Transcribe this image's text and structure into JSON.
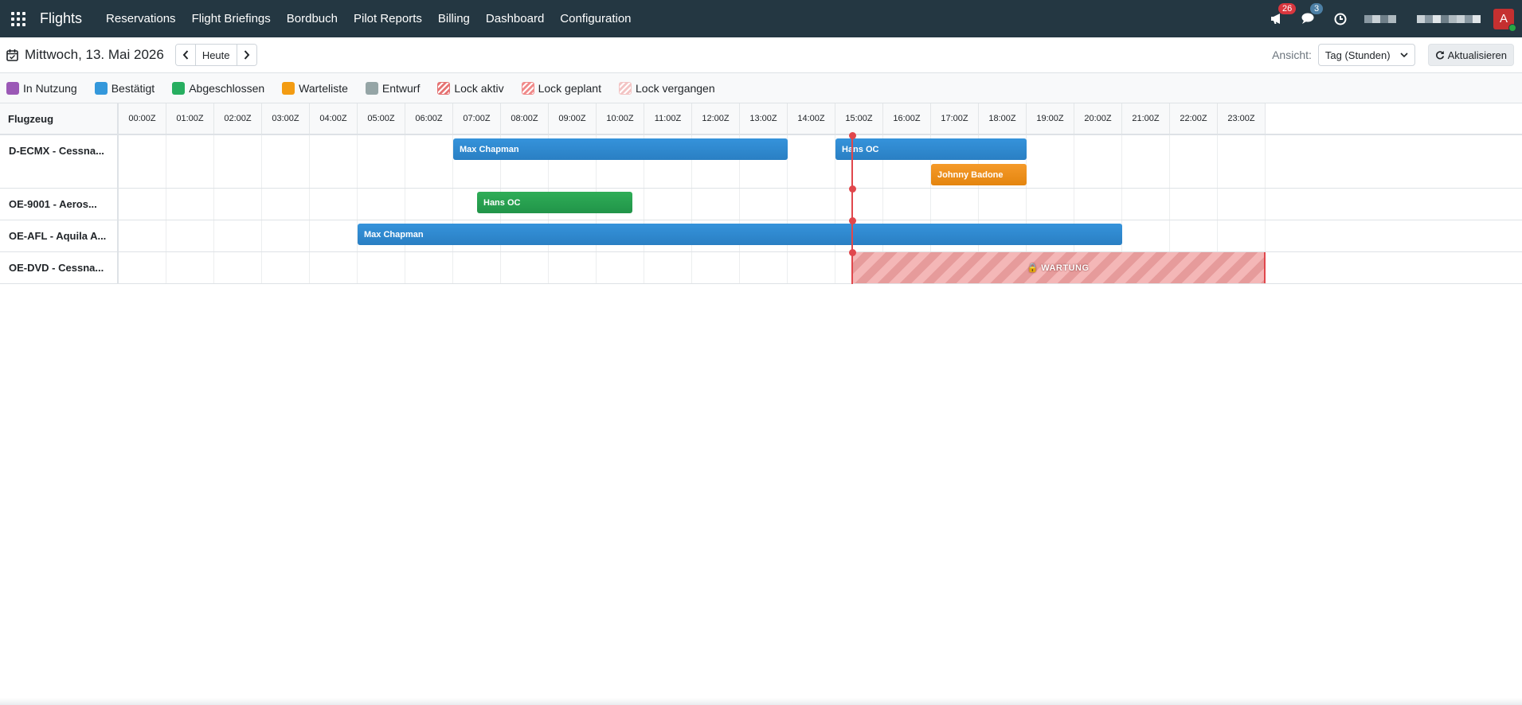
{
  "nav": {
    "brand": "Flights",
    "menu": [
      "Reservations",
      "Flight Briefings",
      "Bordbuch",
      "Pilot Reports",
      "Billing",
      "Dashboard",
      "Configuration"
    ],
    "notifications_count": "26",
    "messages_count": "3",
    "avatar_letter": "A"
  },
  "toolbar": {
    "date": "Mittwoch, 13. Mai 2026",
    "today_label": "Heute",
    "view_label": "Ansicht:",
    "view_value": "Tag (Stunden)",
    "refresh_label": "Aktualisieren"
  },
  "legend": [
    {
      "label": "In Nutzung",
      "color": "#9b59b6"
    },
    {
      "label": "Bestätigt",
      "color": "#3498db"
    },
    {
      "label": "Abgeschlossen",
      "color": "#27ae60"
    },
    {
      "label": "Warteliste",
      "color": "#f39c12"
    },
    {
      "label": "Entwurf",
      "color": "#95a5a6"
    },
    {
      "label": "Lock aktiv",
      "color": "#e57373"
    },
    {
      "label": "Lock geplant",
      "color": "#f08a8a"
    },
    {
      "label": "Lock vergangen",
      "color": "#f3c4c4"
    }
  ],
  "gantt": {
    "aircraft_header": "Flugzeug",
    "hours": [
      "00:00Z",
      "01:00Z",
      "02:00Z",
      "03:00Z",
      "04:00Z",
      "05:00Z",
      "06:00Z",
      "07:00Z",
      "08:00Z",
      "09:00Z",
      "10:00Z",
      "11:00Z",
      "12:00Z",
      "13:00Z",
      "14:00Z",
      "15:00Z",
      "16:00Z",
      "17:00Z",
      "18:00Z",
      "19:00Z",
      "20:00Z",
      "21:00Z",
      "22:00Z",
      "23:00Z"
    ],
    "now_hour": 15.35,
    "rows": [
      {
        "aircraft": "D-ECMX - Cessna...",
        "reservations": [
          {
            "pilot": "Max Chapman",
            "start": 7.0,
            "end": 14.0,
            "status": "blue",
            "lane": 0
          },
          {
            "pilot": "Hans OC",
            "start": 15.0,
            "end": 19.0,
            "status": "blue",
            "lane": 0
          },
          {
            "pilot": "Johnny Badone",
            "start": 17.0,
            "end": 19.0,
            "status": "orange",
            "lane": 1
          }
        ]
      },
      {
        "aircraft": "OE-9001 - Aeros...",
        "reservations": [
          {
            "pilot": "Hans OC",
            "start": 7.5,
            "end": 10.75,
            "status": "green",
            "lane": 0
          }
        ]
      },
      {
        "aircraft": "OE-AFL - Aquila A...",
        "reservations": [
          {
            "pilot": "Max Chapman",
            "start": 5.0,
            "end": 21.0,
            "status": "blue",
            "lane": 0
          }
        ]
      },
      {
        "aircraft": "OE-DVD - Cessna...",
        "reservations": [],
        "locks": [
          {
            "label": "🔒 WARTUNG",
            "start": 15.35,
            "end": 24.0
          }
        ]
      }
    ]
  }
}
